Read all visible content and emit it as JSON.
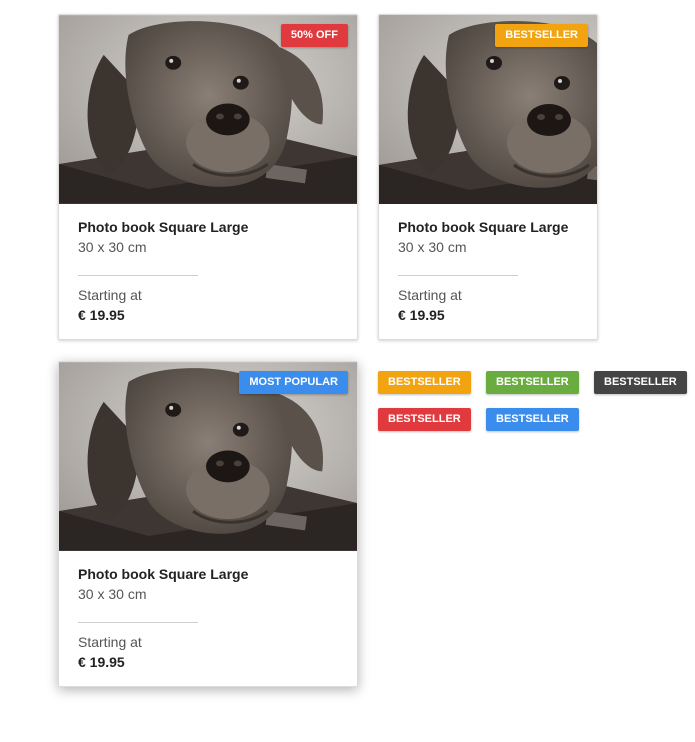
{
  "colors": {
    "sale": "#e03a3e",
    "orange": "#f2a310",
    "green": "#6aac3f",
    "dark": "#444444",
    "red": "#e03a3e",
    "blue": "#3b8ded"
  },
  "cards": [
    {
      "badge": "50% OFF",
      "badge_color": "#e03a3e",
      "title": "Photo book Square Large",
      "dimensions": "30 x 30 cm",
      "starting_label": "Starting at",
      "price": "€ 19.95",
      "image_icon": "dog-photo"
    },
    {
      "badge": "BESTSELLER",
      "badge_color": "#f2a310",
      "title": "Photo book Square Large",
      "dimensions": "30 x 30 cm",
      "starting_label": "Starting at",
      "price": "€ 19.95",
      "image_icon": "dog-photo"
    },
    {
      "badge": "MOST POPULAR",
      "badge_color": "#3b8ded",
      "title": "Photo book Square Large",
      "dimensions": "30 x 30 cm",
      "starting_label": "Starting at",
      "price": "€ 19.95",
      "image_icon": "dog-photo"
    }
  ],
  "badge_samples": [
    {
      "label": "BESTSELLER",
      "color": "#f2a310"
    },
    {
      "label": "BESTSELLER",
      "color": "#6aac3f"
    },
    {
      "label": "BESTSELLER",
      "color": "#444444"
    },
    {
      "label": "BESTSELLER",
      "color": "#e03a3e"
    },
    {
      "label": "BESTSELLER",
      "color": "#3b8ded"
    }
  ]
}
